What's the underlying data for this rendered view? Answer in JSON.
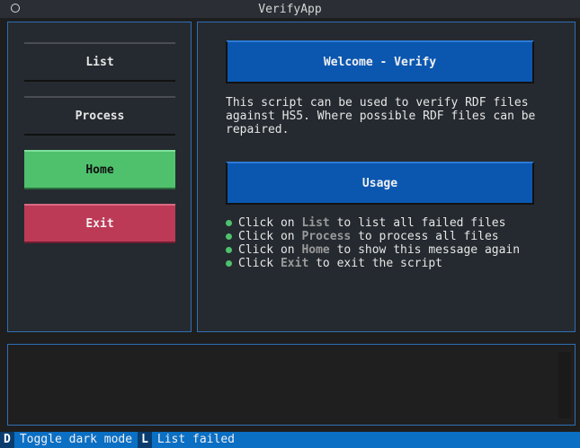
{
  "window": {
    "title": "VerifyApp"
  },
  "sidebar": {
    "items": [
      {
        "label": "List"
      },
      {
        "label": "Process"
      },
      {
        "label": "Home"
      },
      {
        "label": "Exit"
      }
    ]
  },
  "main": {
    "welcome_label": "Welcome - Verify",
    "description": "This script can be used to verify RDF files against HS5. Where possible RDF files can be repaired.",
    "usage_label": "Usage",
    "usage_items": [
      {
        "pre": "Click on ",
        "key": "List",
        "post": " to list all failed files"
      },
      {
        "pre": "Click on ",
        "key": "Process",
        "post": " to process all files"
      },
      {
        "pre": "Click on ",
        "key": "Home",
        "post": " to show this message again"
      },
      {
        "pre": "Click ",
        "key": "Exit",
        "post": " to exit the script"
      }
    ]
  },
  "footer": {
    "bindings": [
      {
        "key": "D",
        "desc": "Toggle dark mode"
      },
      {
        "key": "L",
        "desc": "List failed"
      }
    ]
  },
  "colors": {
    "accent": "#0b57b0",
    "success": "#4fc16d",
    "danger": "#bd3a57",
    "border": "#2f6fb3"
  }
}
